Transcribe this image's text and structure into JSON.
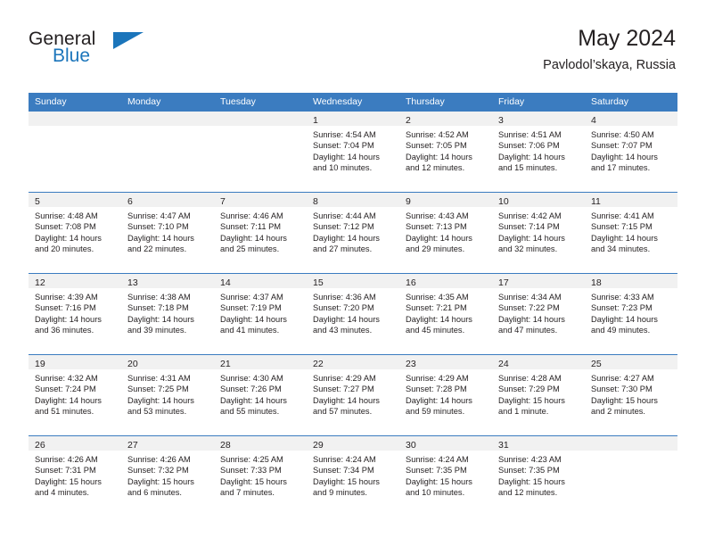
{
  "brand": {
    "name_part1": "General",
    "name_part2": "Blue",
    "logo_icon": "triangle-icon"
  },
  "header": {
    "title": "May 2024",
    "subtitle": "Pavlodol’skaya, Russia"
  },
  "colors": {
    "header_blue": "#3b7cc0",
    "brand_blue": "#1b75bb",
    "daynum_band": "#f1f1f1",
    "text": "#231f20"
  },
  "weekdays": [
    "Sunday",
    "Monday",
    "Tuesday",
    "Wednesday",
    "Thursday",
    "Friday",
    "Saturday"
  ],
  "weeks": [
    [
      {
        "day": "",
        "sunrise": "",
        "sunset": "",
        "daylight1": "",
        "daylight2": ""
      },
      {
        "day": "",
        "sunrise": "",
        "sunset": "",
        "daylight1": "",
        "daylight2": ""
      },
      {
        "day": "",
        "sunrise": "",
        "sunset": "",
        "daylight1": "",
        "daylight2": ""
      },
      {
        "day": "1",
        "sunrise": "Sunrise: 4:54 AM",
        "sunset": "Sunset: 7:04 PM",
        "daylight1": "Daylight: 14 hours",
        "daylight2": "and 10 minutes."
      },
      {
        "day": "2",
        "sunrise": "Sunrise: 4:52 AM",
        "sunset": "Sunset: 7:05 PM",
        "daylight1": "Daylight: 14 hours",
        "daylight2": "and 12 minutes."
      },
      {
        "day": "3",
        "sunrise": "Sunrise: 4:51 AM",
        "sunset": "Sunset: 7:06 PM",
        "daylight1": "Daylight: 14 hours",
        "daylight2": "and 15 minutes."
      },
      {
        "day": "4",
        "sunrise": "Sunrise: 4:50 AM",
        "sunset": "Sunset: 7:07 PM",
        "daylight1": "Daylight: 14 hours",
        "daylight2": "and 17 minutes."
      }
    ],
    [
      {
        "day": "5",
        "sunrise": "Sunrise: 4:48 AM",
        "sunset": "Sunset: 7:08 PM",
        "daylight1": "Daylight: 14 hours",
        "daylight2": "and 20 minutes."
      },
      {
        "day": "6",
        "sunrise": "Sunrise: 4:47 AM",
        "sunset": "Sunset: 7:10 PM",
        "daylight1": "Daylight: 14 hours",
        "daylight2": "and 22 minutes."
      },
      {
        "day": "7",
        "sunrise": "Sunrise: 4:46 AM",
        "sunset": "Sunset: 7:11 PM",
        "daylight1": "Daylight: 14 hours",
        "daylight2": "and 25 minutes."
      },
      {
        "day": "8",
        "sunrise": "Sunrise: 4:44 AM",
        "sunset": "Sunset: 7:12 PM",
        "daylight1": "Daylight: 14 hours",
        "daylight2": "and 27 minutes."
      },
      {
        "day": "9",
        "sunrise": "Sunrise: 4:43 AM",
        "sunset": "Sunset: 7:13 PM",
        "daylight1": "Daylight: 14 hours",
        "daylight2": "and 29 minutes."
      },
      {
        "day": "10",
        "sunrise": "Sunrise: 4:42 AM",
        "sunset": "Sunset: 7:14 PM",
        "daylight1": "Daylight: 14 hours",
        "daylight2": "and 32 minutes."
      },
      {
        "day": "11",
        "sunrise": "Sunrise: 4:41 AM",
        "sunset": "Sunset: 7:15 PM",
        "daylight1": "Daylight: 14 hours",
        "daylight2": "and 34 minutes."
      }
    ],
    [
      {
        "day": "12",
        "sunrise": "Sunrise: 4:39 AM",
        "sunset": "Sunset: 7:16 PM",
        "daylight1": "Daylight: 14 hours",
        "daylight2": "and 36 minutes."
      },
      {
        "day": "13",
        "sunrise": "Sunrise: 4:38 AM",
        "sunset": "Sunset: 7:18 PM",
        "daylight1": "Daylight: 14 hours",
        "daylight2": "and 39 minutes."
      },
      {
        "day": "14",
        "sunrise": "Sunrise: 4:37 AM",
        "sunset": "Sunset: 7:19 PM",
        "daylight1": "Daylight: 14 hours",
        "daylight2": "and 41 minutes."
      },
      {
        "day": "15",
        "sunrise": "Sunrise: 4:36 AM",
        "sunset": "Sunset: 7:20 PM",
        "daylight1": "Daylight: 14 hours",
        "daylight2": "and 43 minutes."
      },
      {
        "day": "16",
        "sunrise": "Sunrise: 4:35 AM",
        "sunset": "Sunset: 7:21 PM",
        "daylight1": "Daylight: 14 hours",
        "daylight2": "and 45 minutes."
      },
      {
        "day": "17",
        "sunrise": "Sunrise: 4:34 AM",
        "sunset": "Sunset: 7:22 PM",
        "daylight1": "Daylight: 14 hours",
        "daylight2": "and 47 minutes."
      },
      {
        "day": "18",
        "sunrise": "Sunrise: 4:33 AM",
        "sunset": "Sunset: 7:23 PM",
        "daylight1": "Daylight: 14 hours",
        "daylight2": "and 49 minutes."
      }
    ],
    [
      {
        "day": "19",
        "sunrise": "Sunrise: 4:32 AM",
        "sunset": "Sunset: 7:24 PM",
        "daylight1": "Daylight: 14 hours",
        "daylight2": "and 51 minutes."
      },
      {
        "day": "20",
        "sunrise": "Sunrise: 4:31 AM",
        "sunset": "Sunset: 7:25 PM",
        "daylight1": "Daylight: 14 hours",
        "daylight2": "and 53 minutes."
      },
      {
        "day": "21",
        "sunrise": "Sunrise: 4:30 AM",
        "sunset": "Sunset: 7:26 PM",
        "daylight1": "Daylight: 14 hours",
        "daylight2": "and 55 minutes."
      },
      {
        "day": "22",
        "sunrise": "Sunrise: 4:29 AM",
        "sunset": "Sunset: 7:27 PM",
        "daylight1": "Daylight: 14 hours",
        "daylight2": "and 57 minutes."
      },
      {
        "day": "23",
        "sunrise": "Sunrise: 4:29 AM",
        "sunset": "Sunset: 7:28 PM",
        "daylight1": "Daylight: 14 hours",
        "daylight2": "and 59 minutes."
      },
      {
        "day": "24",
        "sunrise": "Sunrise: 4:28 AM",
        "sunset": "Sunset: 7:29 PM",
        "daylight1": "Daylight: 15 hours",
        "daylight2": "and 1 minute."
      },
      {
        "day": "25",
        "sunrise": "Sunrise: 4:27 AM",
        "sunset": "Sunset: 7:30 PM",
        "daylight1": "Daylight: 15 hours",
        "daylight2": "and 2 minutes."
      }
    ],
    [
      {
        "day": "26",
        "sunrise": "Sunrise: 4:26 AM",
        "sunset": "Sunset: 7:31 PM",
        "daylight1": "Daylight: 15 hours",
        "daylight2": "and 4 minutes."
      },
      {
        "day": "27",
        "sunrise": "Sunrise: 4:26 AM",
        "sunset": "Sunset: 7:32 PM",
        "daylight1": "Daylight: 15 hours",
        "daylight2": "and 6 minutes."
      },
      {
        "day": "28",
        "sunrise": "Sunrise: 4:25 AM",
        "sunset": "Sunset: 7:33 PM",
        "daylight1": "Daylight: 15 hours",
        "daylight2": "and 7 minutes."
      },
      {
        "day": "29",
        "sunrise": "Sunrise: 4:24 AM",
        "sunset": "Sunset: 7:34 PM",
        "daylight1": "Daylight: 15 hours",
        "daylight2": "and 9 minutes."
      },
      {
        "day": "30",
        "sunrise": "Sunrise: 4:24 AM",
        "sunset": "Sunset: 7:35 PM",
        "daylight1": "Daylight: 15 hours",
        "daylight2": "and 10 minutes."
      },
      {
        "day": "31",
        "sunrise": "Sunrise: 4:23 AM",
        "sunset": "Sunset: 7:35 PM",
        "daylight1": "Daylight: 15 hours",
        "daylight2": "and 12 minutes."
      },
      {
        "day": "",
        "sunrise": "",
        "sunset": "",
        "daylight1": "",
        "daylight2": ""
      }
    ]
  ]
}
